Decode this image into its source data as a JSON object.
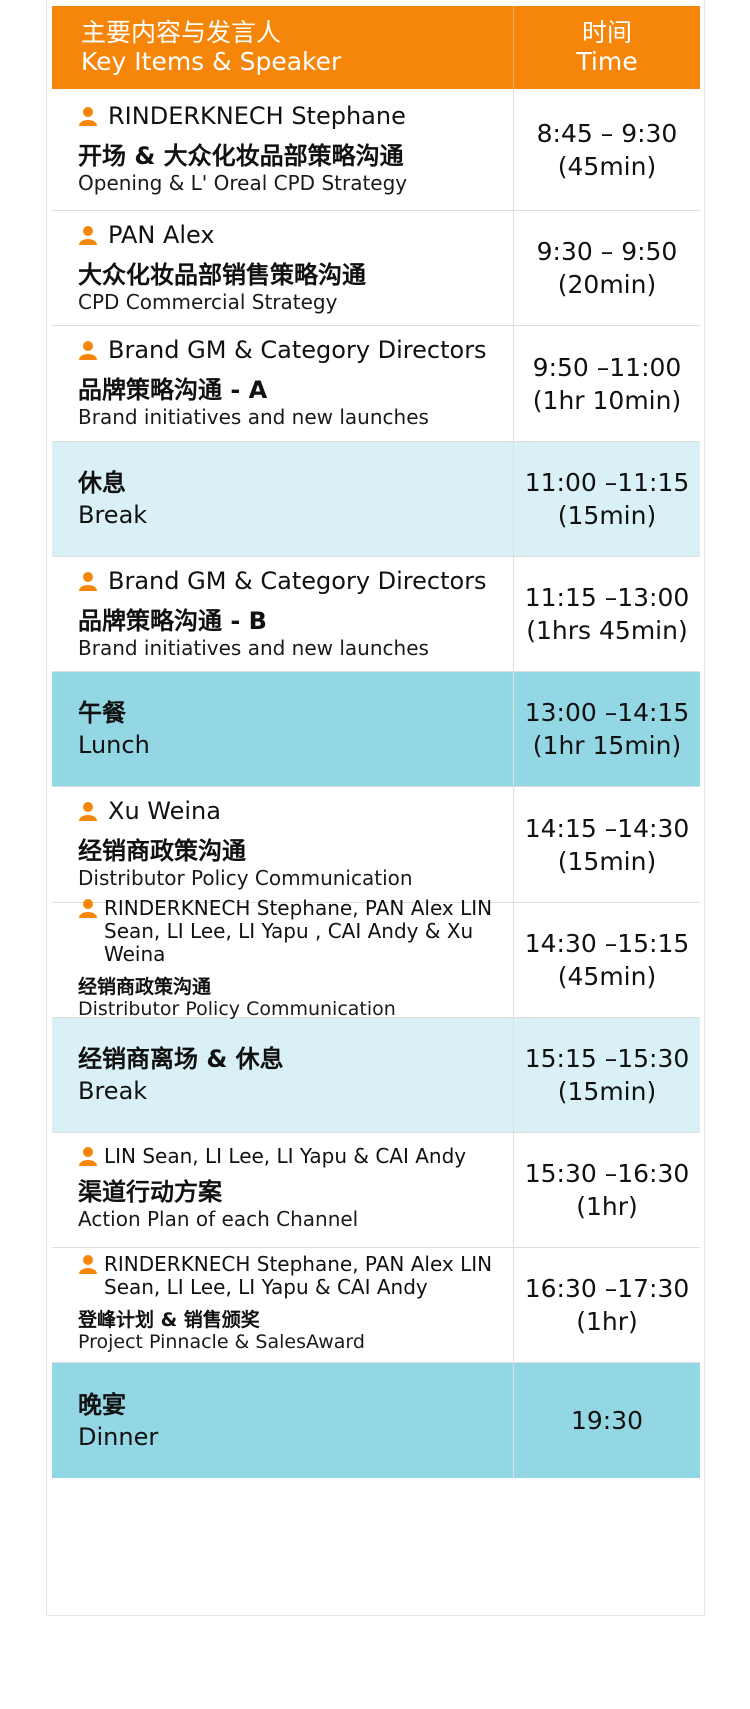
{
  "colors": {
    "header": "#f5860a",
    "break_light": "#d9f1f6",
    "break_dark": "#93d7e5",
    "icon": "#f5860a"
  },
  "header": {
    "items_cn": "主要内容与发言人",
    "items_en": "Key Items & Speaker",
    "time_cn": "时间",
    "time_en": "Time"
  },
  "rows": [
    {
      "speaker": "RINDERKNECH Stephane",
      "title_cn": "开场 & 大众化妆品部策略沟通",
      "title_en": "Opening & L' Oreal CPD Strategy",
      "time": "8:45 – 9:30",
      "duration": "(45min)"
    },
    {
      "speaker": "PAN Alex",
      "title_cn": "大众化妆品部销售策略沟通",
      "title_en": "CPD Commercial Strategy",
      "time": "9:30 – 9:50",
      "duration": "(20min)"
    },
    {
      "speaker": "Brand GM & Category Directors",
      "title_cn": "品牌策略沟通 - A",
      "title_en": "Brand initiatives and new launches",
      "time": "9:50 –11:00",
      "duration": "(1hr 10min)"
    },
    {
      "title_cn": "休息",
      "title_en": "Break",
      "time": "11:00 –11:15",
      "duration": "(15min)"
    },
    {
      "speaker": "Brand GM & Category Directors",
      "title_cn": "品牌策略沟通 - B",
      "title_en": "Brand initiatives and new launches",
      "time": "11:15 –13:00",
      "duration": "(1hrs 45min)"
    },
    {
      "title_cn": "午餐",
      "title_en": "Lunch",
      "time": "13:00 –14:15",
      "duration": "(1hr 15min)"
    },
    {
      "speaker": "Xu Weina",
      "title_cn": "经销商政策沟通",
      "title_en": "Distributor Policy Communication",
      "time": "14:15 –14:30",
      "duration": "(15min)"
    },
    {
      "speaker": "RINDERKNECH Stephane, PAN Alex LIN Sean, LI Lee, LI Yapu , CAI Andy & Xu Weina",
      "title_cn": "经销商政策沟通",
      "title_en": "Distributor Policy Communication",
      "time": "14:30 –15:15",
      "duration": "(45min)"
    },
    {
      "title_cn": "经销商离场 & 休息",
      "title_en": "Break",
      "time": "15:15 –15:30",
      "duration": "(15min)"
    },
    {
      "speaker": "LIN Sean, LI Lee, LI Yapu & CAI Andy",
      "title_cn": "渠道行动方案",
      "title_en": "Action Plan of each Channel",
      "time": "15:30 –16:30",
      "duration": "(1hr)"
    },
    {
      "speaker": "RINDERKNECH Stephane, PAN Alex LIN Sean, LI Lee, LI Yapu & CAI Andy",
      "title_cn": "登峰计划 & 销售颁奖",
      "title_en": "Project Pinnacle & SalesAward",
      "time": "16:30 –17:30",
      "duration": "(1hr)"
    },
    {
      "title_cn": "晚宴",
      "title_en": "Dinner",
      "time": "19:30"
    }
  ]
}
